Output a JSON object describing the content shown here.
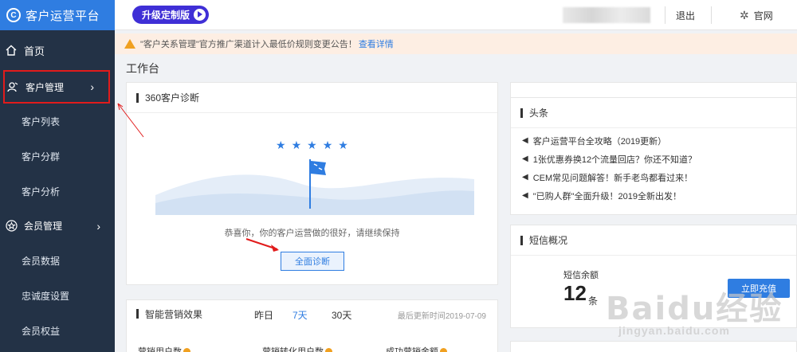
{
  "sidebar": {
    "brand_title": "客户运营平台",
    "items": [
      {
        "label": "首页",
        "icon": "home-icon"
      },
      {
        "label": "客户管理",
        "icon": "customer-icon"
      },
      {
        "label": "客户列表"
      },
      {
        "label": "客户分群"
      },
      {
        "label": "客户分析"
      },
      {
        "label": "会员管理",
        "icon": "star-icon"
      },
      {
        "label": "会员数据"
      },
      {
        "label": "忠诚度设置"
      },
      {
        "label": "会员权益"
      }
    ]
  },
  "topbar": {
    "upgrade_label": "升级定制版",
    "logout_label": "退出",
    "official_label": "官网"
  },
  "notice": {
    "text": "\"客户关系管理\"官方推广渠道计入最低价规则变更公告！",
    "link": "查看详情"
  },
  "page_title": "工作台",
  "diagnosis": {
    "title": "360客户诊断",
    "message": "恭喜你，你的客户运营做的很好，请继续保持",
    "button": "全面诊断"
  },
  "effect": {
    "title": "智能营销效果",
    "tabs": [
      "昨日",
      "7天",
      "30天"
    ],
    "selected_tab": "7天",
    "updated": "最后更新时间2019-07-09",
    "metrics": [
      "营销用户数",
      "营销转化用户数",
      "成功营销金额"
    ]
  },
  "headline": {
    "title": "头条",
    "items": [
      "客户运营平台全攻略（2019更新）",
      "1张优惠券换12个流量回店？你还不知道？",
      "CEM常见问题解答！新手老鸟都看过来！",
      "\"已购人群\"全面升级！2019全新出发！"
    ]
  },
  "sms": {
    "title": "短信概况",
    "balance_label": "短信余额",
    "balance_value": "12",
    "balance_unit": "条",
    "recharge_button": "立即充值"
  },
  "watermark": {
    "big": "Baidu经验",
    "small": "jingyan.baidu.com"
  },
  "colors": {
    "sidebar_bg": "#233246",
    "brand_bg": "#2f7de1",
    "accent": "#2f7de1",
    "upgrade_bg": "#3f2fd6",
    "highlight_border": "#e11b1b"
  }
}
